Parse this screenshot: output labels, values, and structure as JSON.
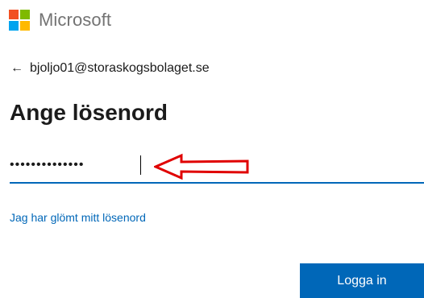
{
  "brand": {
    "name": "Microsoft",
    "logo_colors": [
      "#f25022",
      "#7fba00",
      "#00a4ef",
      "#ffb900"
    ]
  },
  "identity": {
    "back_icon": "arrow-left-icon",
    "email": "bjoljo01@storaskogsbolaget.se"
  },
  "page": {
    "title": "Ange lösenord"
  },
  "password": {
    "value": "••••••••••••••",
    "accent_color": "#0067b8"
  },
  "annotation": {
    "arrow_icon": "red-outline-arrow-left-icon",
    "color": "#e00000"
  },
  "links": {
    "forgot_password": "Jag har glömt mitt lösenord"
  },
  "actions": {
    "sign_in_label": "Logga in"
  }
}
